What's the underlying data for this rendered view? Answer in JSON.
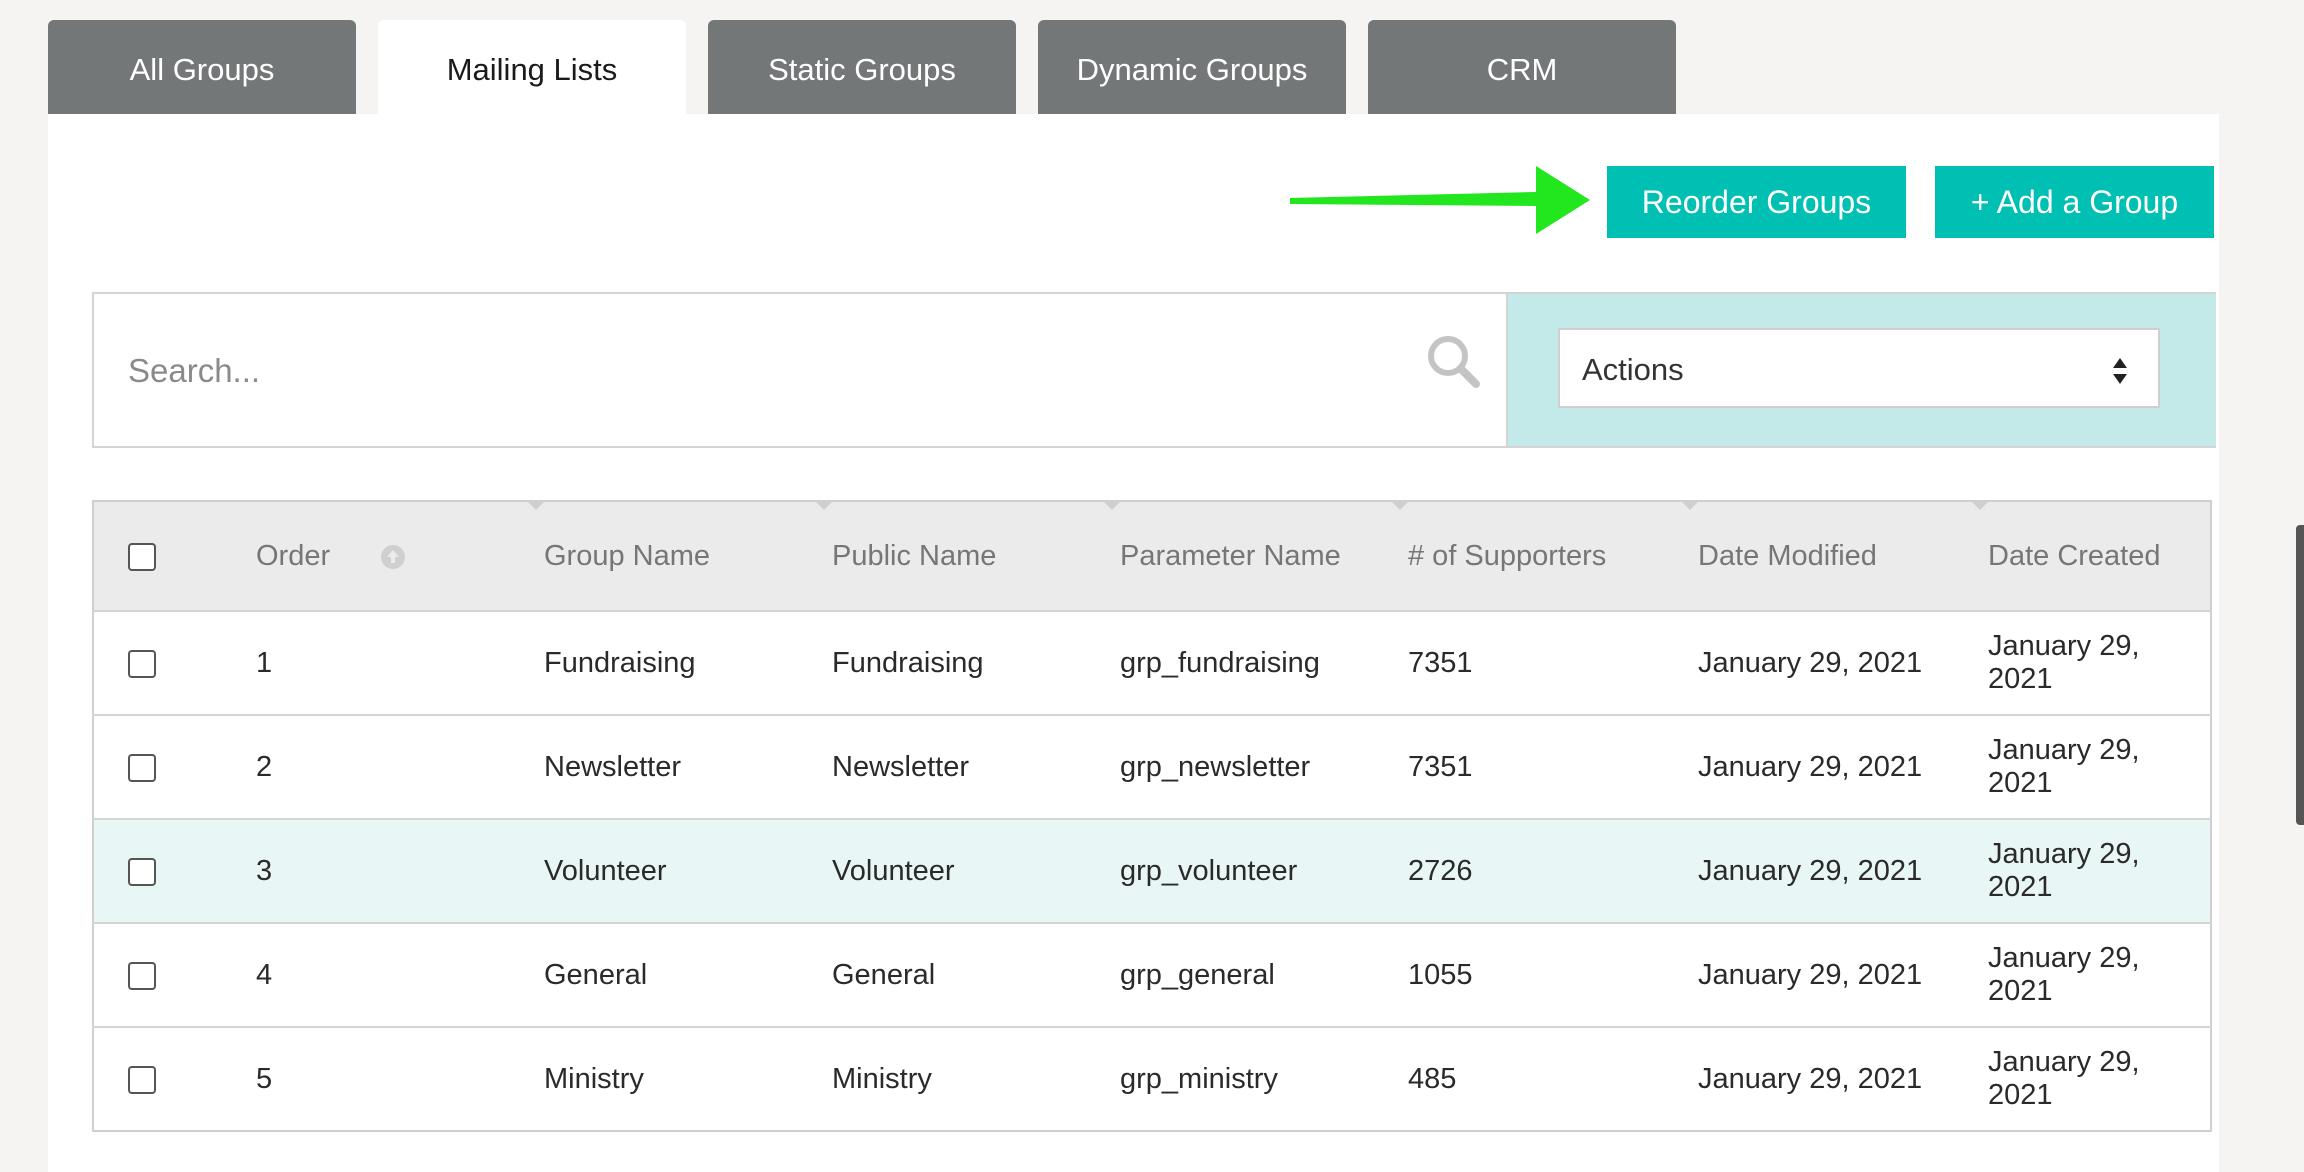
{
  "tabs": [
    {
      "label": "All Groups",
      "active": false
    },
    {
      "label": "Mailing Lists",
      "active": true
    },
    {
      "label": "Static Groups",
      "active": false
    },
    {
      "label": "Dynamic Groups",
      "active": false
    },
    {
      "label": "CRM",
      "active": false
    }
  ],
  "buttons": {
    "reorder_label": "Reorder Groups",
    "add_label": "+ Add a Group"
  },
  "search": {
    "placeholder": "Search..."
  },
  "actions": {
    "selected": "Actions"
  },
  "table": {
    "headers": {
      "order": "Order",
      "group_name": "Group Name",
      "public_name": "Public Name",
      "parameter_name": "Parameter Name",
      "supporters": "# of Supporters",
      "date_modified": "Date Modified",
      "date_created": "Date Created"
    },
    "rows": [
      {
        "order": "1",
        "group_name": "Fundraising",
        "public_name": "Fundraising",
        "parameter_name": "grp_fundraising",
        "supporters": "7351",
        "date_modified": "January 29, 2021",
        "date_created": "January 29, 2021"
      },
      {
        "order": "2",
        "group_name": "Newsletter",
        "public_name": "Newsletter",
        "parameter_name": "grp_newsletter",
        "supporters": "7351",
        "date_modified": "January 29, 2021",
        "date_created": "January 29, 2021"
      },
      {
        "order": "3",
        "group_name": "Volunteer",
        "public_name": "Volunteer",
        "parameter_name": "grp_volunteer",
        "supporters": "2726",
        "date_modified": "January 29, 2021",
        "date_created": "January 29, 2021"
      },
      {
        "order": "4",
        "group_name": "General",
        "public_name": "General",
        "parameter_name": "grp_general",
        "supporters": "1055",
        "date_modified": "January 29, 2021",
        "date_created": "January 29, 2021"
      },
      {
        "order": "5",
        "group_name": "Ministry",
        "public_name": "Ministry",
        "parameter_name": "grp_ministry",
        "supporters": "485",
        "date_modified": "January 29, 2021",
        "date_created": "January 29, 2021"
      }
    ]
  },
  "colors": {
    "accent": "#00bfb3",
    "tab_inactive": "#737778",
    "arrow": "#22e61e",
    "row_highlight": "#e8f7f6"
  }
}
